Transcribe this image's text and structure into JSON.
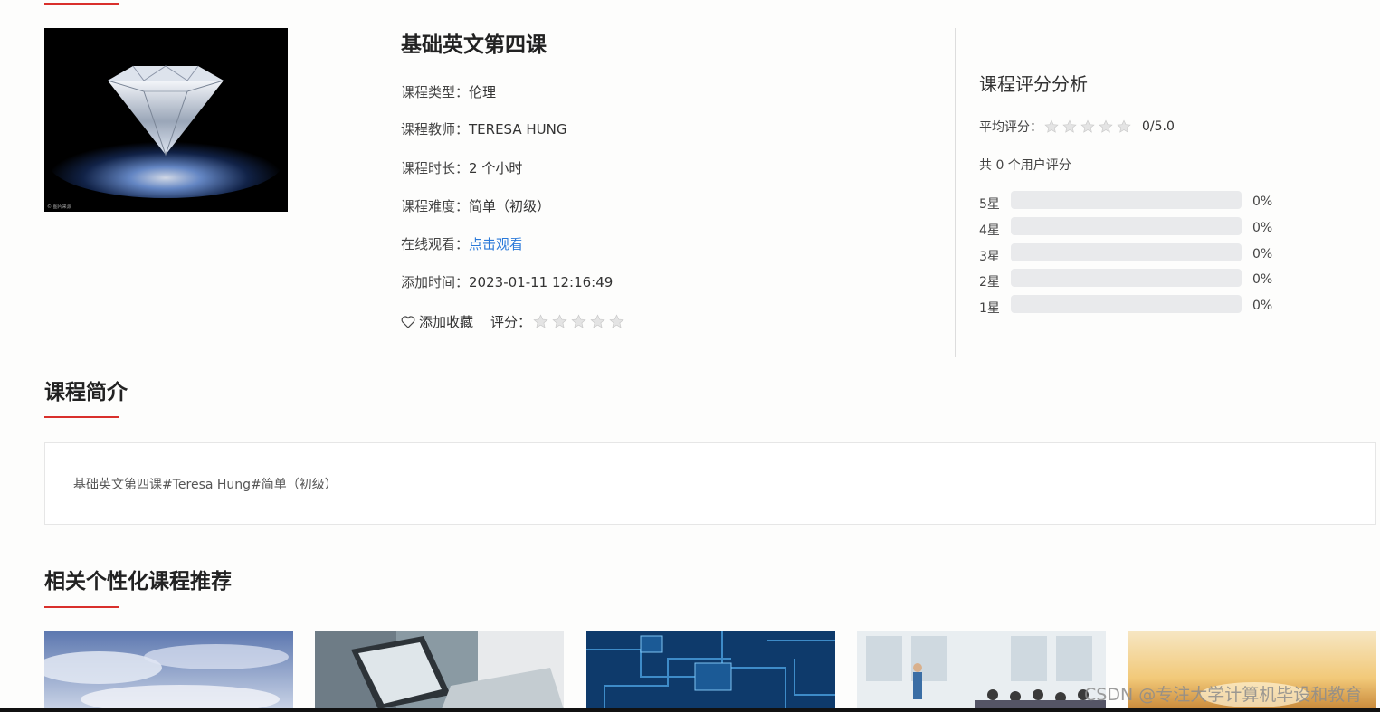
{
  "course": {
    "title": "基础英文第四课",
    "type_label": "课程类型：",
    "type_value": "伦理",
    "teacher_label": "课程教师：",
    "teacher_value": "TERESA HUNG",
    "duration_label": "课程时长：",
    "duration_value": "2 个小时",
    "difficulty_label": "课程难度：",
    "difficulty_value": "简单（初级）",
    "watch_label": "在线观看：",
    "watch_link": "点击观看",
    "added_label": "添加时间：",
    "added_value": "2023-01-11 12:16:49",
    "cover_caption": "© 图片来源",
    "favorite_label": "添加收藏",
    "rate_label": "评分：",
    "rate_stars": 0
  },
  "analysis": {
    "title": "课程评分分析",
    "avg_label": "平均评分：",
    "avg_stars": 0,
    "avg_score": "0/5.0",
    "total_text": "共 0 个用户评分",
    "distribution": [
      {
        "label": "5星",
        "percent": 0,
        "percent_text": "0%"
      },
      {
        "label": "4星",
        "percent": 0,
        "percent_text": "0%"
      },
      {
        "label": "3星",
        "percent": 0,
        "percent_text": "0%"
      },
      {
        "label": "2星",
        "percent": 0,
        "percent_text": "0%"
      },
      {
        "label": "1星",
        "percent": 0,
        "percent_text": "0%"
      }
    ]
  },
  "intro": {
    "heading": "课程简介",
    "text": "基础英文第四课#Teresa Hung#简单（初级）"
  },
  "recommend": {
    "heading": "相关个性化课程推荐",
    "thumbnails": [
      "sky-clouds",
      "laptop-writing",
      "circuit-board",
      "classroom-presentation",
      "sunset-field"
    ]
  },
  "watermark": "CSDN @专注大学计算机毕设和教育",
  "colors": {
    "accent": "#d9302c",
    "link": "#2a79d9",
    "bar_bg": "#e9eaec"
  }
}
